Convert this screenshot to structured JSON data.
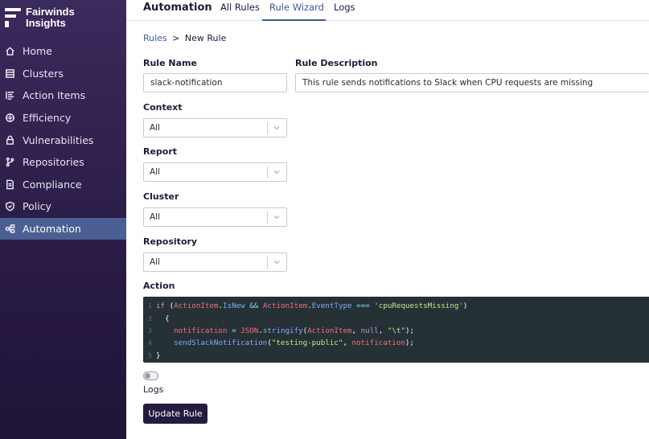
{
  "sidebar": {
    "logo": {
      "line1": "Fairwinds",
      "line2": "Insights"
    },
    "items": [
      {
        "label": "Home",
        "icon": "home-icon"
      },
      {
        "label": "Clusters",
        "icon": "clusters-icon"
      },
      {
        "label": "Action Items",
        "icon": "action-items-icon"
      },
      {
        "label": "Efficiency",
        "icon": "efficiency-icon"
      },
      {
        "label": "Vulnerabilities",
        "icon": "lock-icon"
      },
      {
        "label": "Repositories",
        "icon": "git-branch-icon"
      },
      {
        "label": "Compliance",
        "icon": "document-icon"
      },
      {
        "label": "Policy",
        "icon": "shield-icon"
      },
      {
        "label": "Automation",
        "icon": "automation-icon",
        "active": true
      }
    ]
  },
  "header": {
    "title": "Automation",
    "tabs": [
      {
        "label": "All Rules"
      },
      {
        "label": "Rule Wizard",
        "active": true
      },
      {
        "label": "Logs"
      }
    ]
  },
  "breadcrumb": {
    "root": "Rules",
    "separator": ">",
    "current": "New Rule"
  },
  "form": {
    "rule_name": {
      "label": "Rule Name",
      "value": "slack-notification"
    },
    "rule_description": {
      "label": "Rule Description",
      "value": "This rule sends notifications to Slack when CPU requests are missing"
    },
    "context": {
      "label": "Context",
      "value": "All"
    },
    "report": {
      "label": "Report",
      "value": "All"
    },
    "cluster": {
      "label": "Cluster",
      "value": "All"
    },
    "repository": {
      "label": "Repository",
      "value": "All"
    },
    "action": {
      "label": "Action",
      "line_numbers": [
        "1",
        "2",
        "3",
        "4",
        "5"
      ],
      "code": [
        "if (ActionItem.IsNew && ActionItem.EventType === 'cpuRequestsMissing')",
        "  {",
        "    notification = JSON.stringify(ActionItem, null, \"\\t\");",
        "    sendSlackNotification(\"testing-public\", notification);",
        "}"
      ]
    },
    "logs_toggle": {
      "label": "Logs",
      "enabled": false
    },
    "submit_label": "Update Rule"
  },
  "colors": {
    "sidebar_top": "#3b2a5c",
    "sidebar_bottom": "#201437",
    "active_nav": "#4a5f93",
    "accent": "#3c5a92",
    "button": "#251a40",
    "editor_bg": "#263136"
  }
}
